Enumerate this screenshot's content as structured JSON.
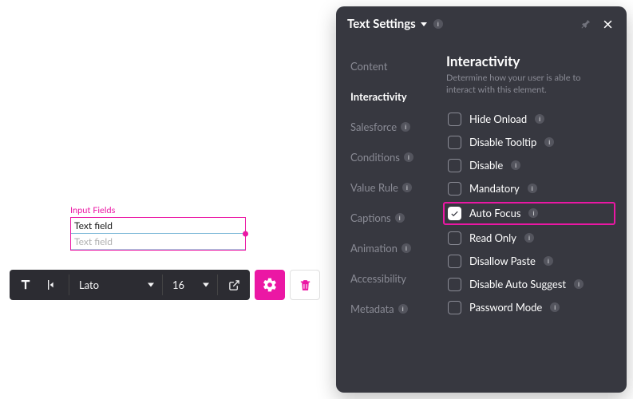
{
  "canvas": {
    "group_label": "Input Fields",
    "row1": "Text field",
    "row2": "Text field"
  },
  "toolbar": {
    "font_family": "Lato",
    "font_size": "16"
  },
  "panel": {
    "title": "Text Settings",
    "sidebar": {
      "content": "Content",
      "interactivity": "Interactivity",
      "salesforce": "Salesforce",
      "conditions": "Conditions",
      "value_rule": "Value Rule",
      "captions": "Captions",
      "animation": "Animation",
      "accessibility": "Accessibility",
      "metadata": "Metadata"
    },
    "section": {
      "title": "Interactivity",
      "desc": "Determine how your user is able to interact with this element."
    },
    "options": {
      "hide_onload": "Hide Onload",
      "disable_tooltip": "Disable Tooltip",
      "disable": "Disable",
      "mandatory": "Mandatory",
      "auto_focus": "Auto Focus",
      "read_only": "Read Only",
      "disallow_paste": "Disallow Paste",
      "disable_auto_suggest": "Disable Auto Suggest",
      "password_mode": "Password Mode"
    }
  }
}
